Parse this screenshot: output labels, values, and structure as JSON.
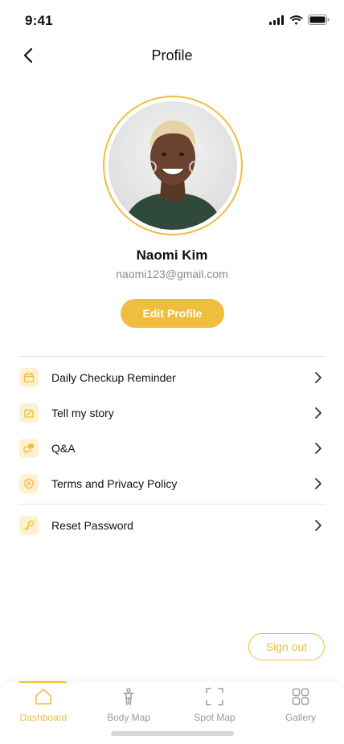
{
  "status_bar": {
    "time": "9:41"
  },
  "header": {
    "title": "Profile"
  },
  "profile": {
    "name": "Naomi Kim",
    "email": "naomi123@gmail.com",
    "edit_label": "Edit Profile"
  },
  "menu": {
    "items": [
      {
        "label": "Daily Checkup Reminder",
        "icon": "calendar-icon"
      },
      {
        "label": "Tell my story",
        "icon": "story-icon"
      },
      {
        "label": "Q&A",
        "icon": "chat-icon"
      },
      {
        "label": "Terms and Privacy Policy",
        "icon": "shield-icon"
      },
      {
        "label": "Reset Password",
        "icon": "key-icon"
      }
    ]
  },
  "signout_label": "Sign out",
  "tabs": [
    {
      "label": "Dashboard",
      "icon": "home-icon",
      "active": true
    },
    {
      "label": "Body Map",
      "icon": "body-icon",
      "active": false
    },
    {
      "label": "Spot Map",
      "icon": "scan-icon",
      "active": false
    },
    {
      "label": "Gallery",
      "icon": "grid-icon",
      "active": false
    }
  ],
  "colors": {
    "accent": "#EFBE3E",
    "accent_light": "#FDF1CF",
    "text": "#111111",
    "muted": "#8A8A8A"
  }
}
